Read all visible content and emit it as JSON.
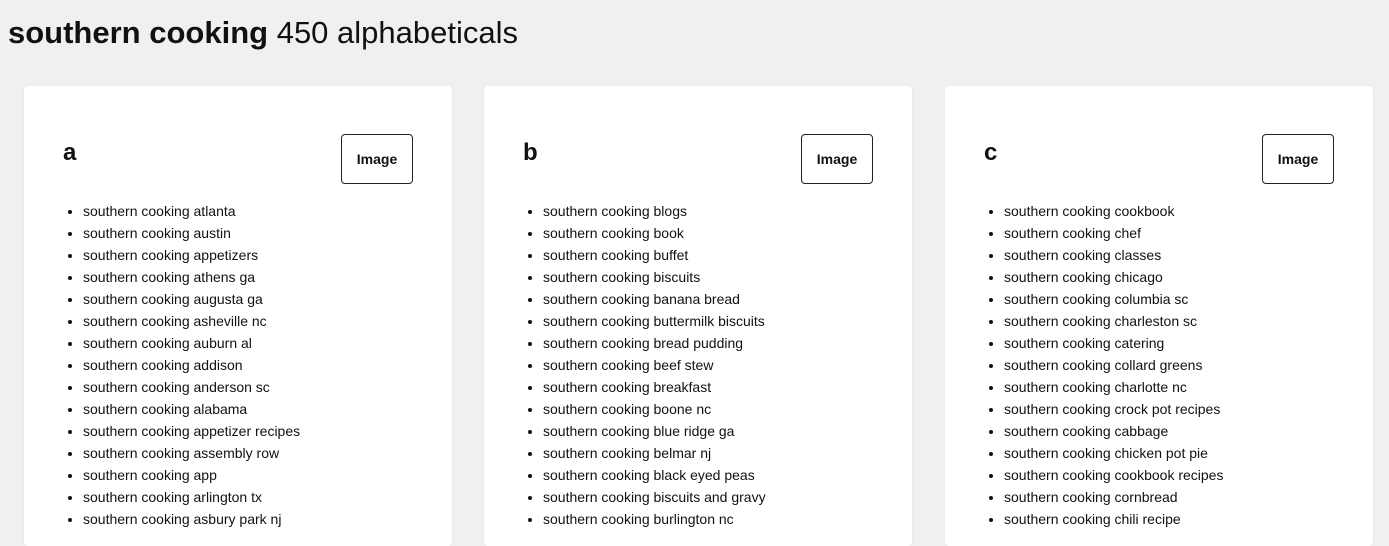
{
  "header": {
    "topic": "southern cooking",
    "subtitle": "450 alphabeticals"
  },
  "cards": [
    {
      "letter": "a",
      "image_button_label": "Image",
      "items": [
        "southern cooking atlanta",
        "southern cooking austin",
        "southern cooking appetizers",
        "southern cooking athens ga",
        "southern cooking augusta ga",
        "southern cooking asheville nc",
        "southern cooking auburn al",
        "southern cooking addison",
        "southern cooking anderson sc",
        "southern cooking alabama",
        "southern cooking appetizer recipes",
        "southern cooking assembly row",
        "southern cooking app",
        "southern cooking arlington tx",
        "southern cooking asbury park nj"
      ]
    },
    {
      "letter": "b",
      "image_button_label": "Image",
      "items": [
        "southern cooking blogs",
        "southern cooking book",
        "southern cooking buffet",
        "southern cooking biscuits",
        "southern cooking banana bread",
        "southern cooking buttermilk biscuits",
        "southern cooking bread pudding",
        "southern cooking beef stew",
        "southern cooking breakfast",
        "southern cooking boone nc",
        "southern cooking blue ridge ga",
        "southern cooking belmar nj",
        "southern cooking black eyed peas",
        "southern cooking biscuits and gravy",
        "southern cooking burlington nc"
      ]
    },
    {
      "letter": "c",
      "image_button_label": "Image",
      "items": [
        "southern cooking cookbook",
        "southern cooking chef",
        "southern cooking classes",
        "southern cooking chicago",
        "southern cooking columbia sc",
        "southern cooking charleston sc",
        "southern cooking catering",
        "southern cooking collard greens",
        "southern cooking charlotte nc",
        "southern cooking crock pot recipes",
        "southern cooking cabbage",
        "southern cooking chicken pot pie",
        "southern cooking cookbook recipes",
        "southern cooking cornbread",
        "southern cooking chili recipe"
      ]
    }
  ]
}
